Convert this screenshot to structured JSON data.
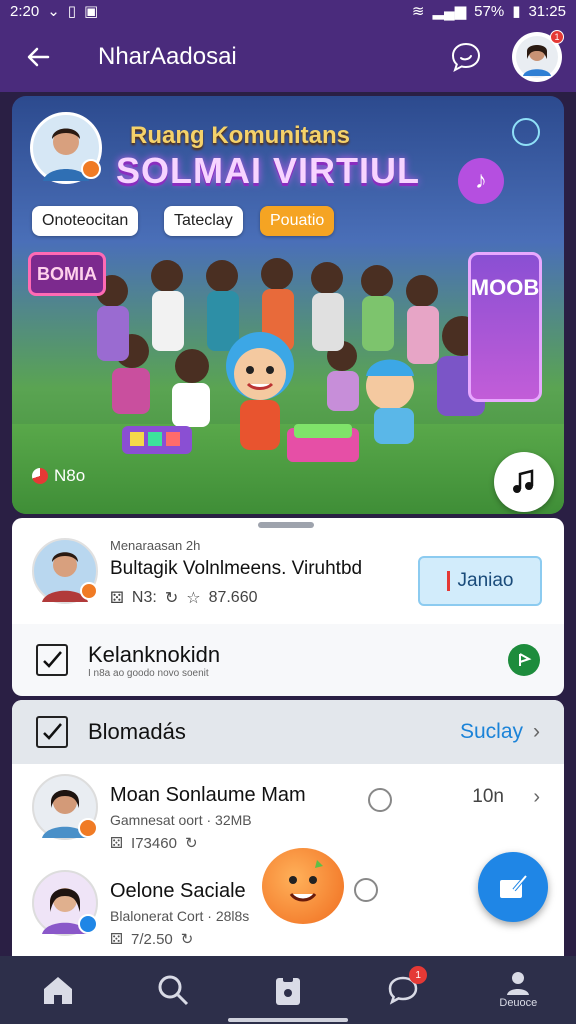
{
  "status_bar": {
    "time": "2:20",
    "battery": "57%",
    "clock_right": "31:25"
  },
  "app_bar": {
    "title": "NharAadosai",
    "notification_count": "1"
  },
  "hero": {
    "title_line1": "Ruang Komunitans",
    "title_line2": "SOLMAI VIRTIUL",
    "chips": [
      "Onoteocitan",
      "Tateclay",
      "Pouatio"
    ],
    "board_left": "BOMIA",
    "board_right": "MOOB",
    "footer_label": "N8o"
  },
  "featured": {
    "subtitle": "Menaraasan 2h",
    "title": "Bultagik Volnlmeens. Viruhtbd",
    "meta_code": "N3:",
    "meta_rating": "87.660",
    "join_label": "Janiao"
  },
  "checklist": {
    "title": "Kelanknokidn",
    "description": "I n8a ao goodo novo soenit"
  },
  "list": {
    "header_title": "Blomadás",
    "header_action": "Suclay",
    "items": [
      {
        "name": "Moan Sonlaume Mam",
        "subtitle": "Gamnesat oort · 32MB",
        "meta": "I73460",
        "time": "10n",
        "dot_color": "#f07b25"
      },
      {
        "name": "Oelone Saciale",
        "subtitle": "Blalonerat Cort · 28l8s",
        "meta": "7/2.50",
        "time": "",
        "dot_color": "#1f86e6"
      }
    ]
  },
  "bottom_nav": {
    "items": [
      "home-icon",
      "search-icon",
      "clipboard-icon",
      "chat-icon",
      "profile-icon"
    ],
    "profile_label": "Deuoce",
    "chat_badge": "1"
  },
  "colors": {
    "primary_purple": "#4a2b7c",
    "accent_blue": "#1f86e6",
    "nav_bg": "#2d2f4a"
  }
}
